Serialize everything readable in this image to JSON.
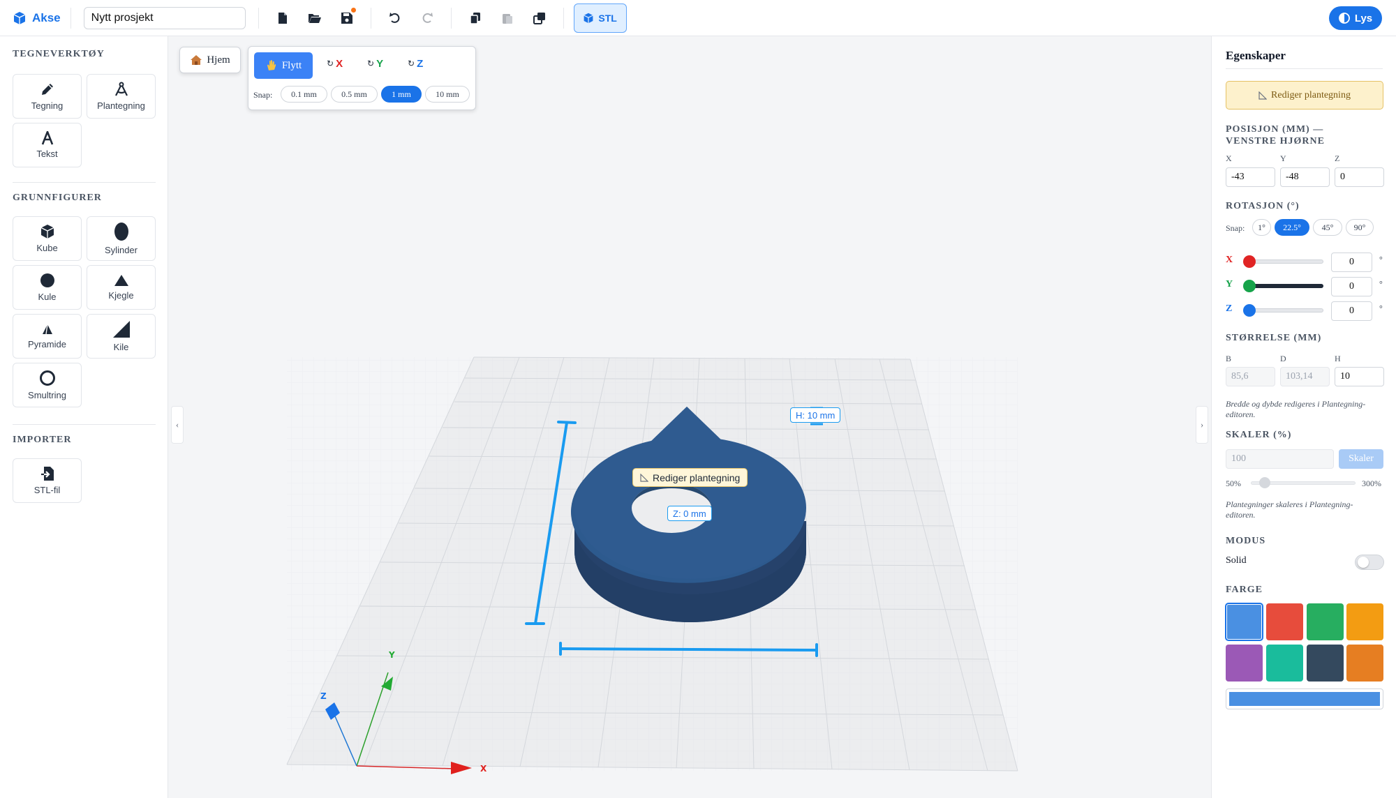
{
  "app": {
    "name": "Akse",
    "project_name": "Nytt prosjekt",
    "stl_label": "STL",
    "theme_label": "Lys"
  },
  "left": {
    "drawing_title": "TEGNEVERKTØY",
    "drawing_tools": [
      "Tegning",
      "Plantegning",
      "Tekst"
    ],
    "shapes_title": "GRUNNFIGURER",
    "shapes": [
      "Kube",
      "Sylinder",
      "Kule",
      "Kjegle",
      "Pyramide",
      "Kile",
      "Smultring"
    ],
    "import_title": "IMPORTER",
    "import_items": [
      "STL-fil"
    ]
  },
  "canvas": {
    "home_label": "Hjem",
    "move_label": "Flytt",
    "rot_x": "X",
    "rot_y": "Y",
    "rot_z": "Z",
    "snap_label": "Snap:",
    "snap_options": [
      "0.1 mm",
      "0.5 mm",
      "1 mm",
      "10 mm"
    ],
    "snap_selected": "1 mm",
    "height_tag": "H: 10 mm",
    "z_tag": "Z: 0 mm",
    "edit_floorplan_tag": "Rediger plantegning",
    "axis_x": "X",
    "axis_y": "Y",
    "axis_z": "Z",
    "collapse_left": "‹",
    "collapse_right": "›"
  },
  "right": {
    "title": "Egenskaper",
    "edit_button": "Rediger plantegning",
    "position_title": "POSISJON (MM) — VENSTRE HJØRNE",
    "position": {
      "x_label": "X",
      "y_label": "Y",
      "z_label": "Z",
      "x": "-43",
      "y": "-48",
      "z": "0"
    },
    "rotation_title": "ROTASJON (°)",
    "rotation_snap_label": "Snap:",
    "rotation_snaps": [
      "1°",
      "22.5°",
      "45°",
      "90°"
    ],
    "rotation_snap_selected": "22.5°",
    "rotation": {
      "x_label": "X",
      "y_label": "Y",
      "z_label": "Z",
      "x": "0",
      "y": "0",
      "z": "0",
      "unit": "°"
    },
    "size_title": "STØRRELSE (MM)",
    "size": {
      "b_label": "B",
      "d_label": "D",
      "h_label": "H",
      "b": "85,6",
      "d": "103,14",
      "h": "10"
    },
    "size_note": "Bredde og dybde redigeres i Plantegning-editoren.",
    "scale_title": "SKALER (%)",
    "scale_value": "100",
    "scale_button": "Skaler",
    "scale_min": "50%",
    "scale_max": "300%",
    "scale_note": "Plantegninger skaleres i Plantegning-editoren.",
    "mode_title": "MODUS",
    "mode_label": "Solid",
    "color_title": "FARGE",
    "colors": [
      "#4a90e2",
      "#e74c3c",
      "#27ae60",
      "#f39c12",
      "#9b59b6",
      "#1abc9c",
      "#34495e",
      "#e67e22"
    ],
    "selected_color": "#4a90e2"
  }
}
